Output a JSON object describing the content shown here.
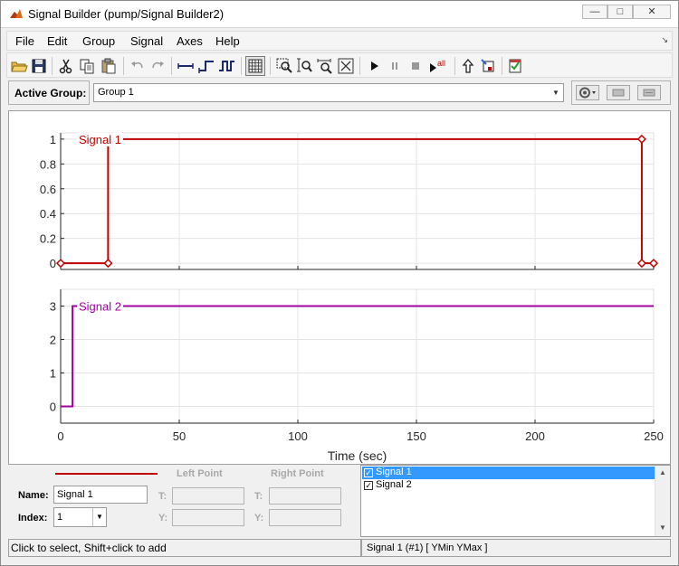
{
  "window": {
    "title": "Signal Builder (pump/Signal Builder2)",
    "controls": {
      "minimize": "—",
      "maximize": "□",
      "close": "✕"
    }
  },
  "menu": {
    "items": [
      "File",
      "Edit",
      "Group",
      "Signal",
      "Axes",
      "Help"
    ],
    "corner": "↘"
  },
  "toolbar": {
    "icons": [
      "open-folder-icon",
      "save-icon",
      "cut-icon",
      "copy-icon",
      "paste-icon",
      "undo-icon",
      "redo-icon",
      "constant-signal-icon",
      "step-signal-icon",
      "pulse-signal-icon",
      "grid-icon",
      "zoom-xy-icon",
      "zoom-y-icon",
      "zoom-x-icon",
      "fit-view-icon",
      "play-icon",
      "pause-icon",
      "stop-icon",
      "run-all-icon",
      "export-icon",
      "simulink-block-icon",
      "requirements-icon"
    ],
    "run_all_label": "all"
  },
  "active_group": {
    "label": "Active Group:",
    "value": "Group 1",
    "buttons": [
      "group-settings-icon",
      "move-group-icon",
      "display-group-icon"
    ]
  },
  "colors": {
    "signal1": "#c00000",
    "signal2": "#a000a0",
    "selection": "#3399ff",
    "grid": "#e4e4e4"
  },
  "chart_data": [
    {
      "type": "line",
      "series": [
        {
          "name": "Signal 1",
          "x": [
            0,
            20,
            20,
            245,
            245,
            250
          ],
          "y": [
            0,
            0,
            1,
            1,
            0,
            0
          ]
        }
      ],
      "xlim": [
        0,
        250
      ],
      "ylim": [
        -0.05,
        1.05
      ],
      "yticks": [
        0,
        0.2,
        0.4,
        0.6,
        0.8,
        1
      ],
      "ytick_labels": [
        "0",
        "0.2",
        "0.4",
        "0.6",
        "0.8",
        "1"
      ],
      "xticks": [
        0,
        50,
        100,
        150,
        200,
        250
      ],
      "grid": true,
      "markers": "diamond"
    },
    {
      "type": "line",
      "series": [
        {
          "name": "Signal 2",
          "x": [
            0,
            5,
            5,
            250
          ],
          "y": [
            0,
            0,
            3,
            3
          ]
        }
      ],
      "xlim": [
        0,
        250
      ],
      "ylim": [
        -0.5,
        3.5
      ],
      "yticks": [
        0,
        1,
        2,
        3
      ],
      "ytick_labels": [
        "0",
        "1",
        "2",
        "3"
      ],
      "xticks": [
        0,
        50,
        100,
        150,
        200,
        250
      ],
      "xtick_labels": [
        "0",
        "50",
        "100",
        "150",
        "200",
        "250"
      ],
      "xlabel": "Time (sec)",
      "grid": true
    }
  ],
  "editor": {
    "left_point_label": "Left Point",
    "right_point_label": "Right Point",
    "t_label": "T:",
    "y_label": "Y:",
    "name_label": "Name:",
    "name_value": "Signal 1",
    "index_label": "Index:",
    "index_value": "1"
  },
  "signal_list": [
    {
      "name": "Signal 1",
      "checked": true,
      "selected": true,
      "check_mark": "✓"
    },
    {
      "name": "Signal 2",
      "checked": true,
      "selected": false,
      "check_mark": "✓"
    }
  ],
  "scroll": {
    "up": "▲",
    "down": "▼"
  },
  "status": {
    "left": "Click to select, Shift+click to add",
    "right": "Signal 1 (#1)  [ YMin YMax ]"
  }
}
